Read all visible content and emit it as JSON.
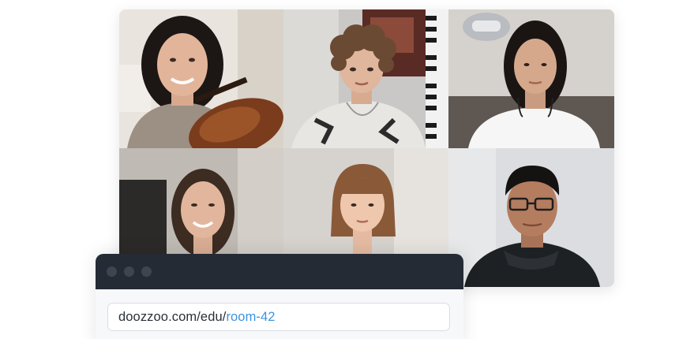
{
  "browser": {
    "url_base": "doozzoo.com/edu/",
    "url_room": "room-42",
    "window_controls": [
      "window-dot",
      "window-dot",
      "window-dot"
    ]
  },
  "video_grid": {
    "participant_count": 6,
    "participants": [
      {
        "description_icon": "participant-violinist-video"
      },
      {
        "description_icon": "participant-curly-hair-video"
      },
      {
        "description_icon": "participant-white-shirt-video"
      },
      {
        "description_icon": "participant-smiling-woman-video"
      },
      {
        "description_icon": "participant-girl-bob-video"
      },
      {
        "description_icon": "participant-glasses-man-video"
      }
    ]
  },
  "colors": {
    "browser_bar": "#242b35",
    "url_accent": "#3c94e0",
    "url_text": "#2b3038"
  }
}
